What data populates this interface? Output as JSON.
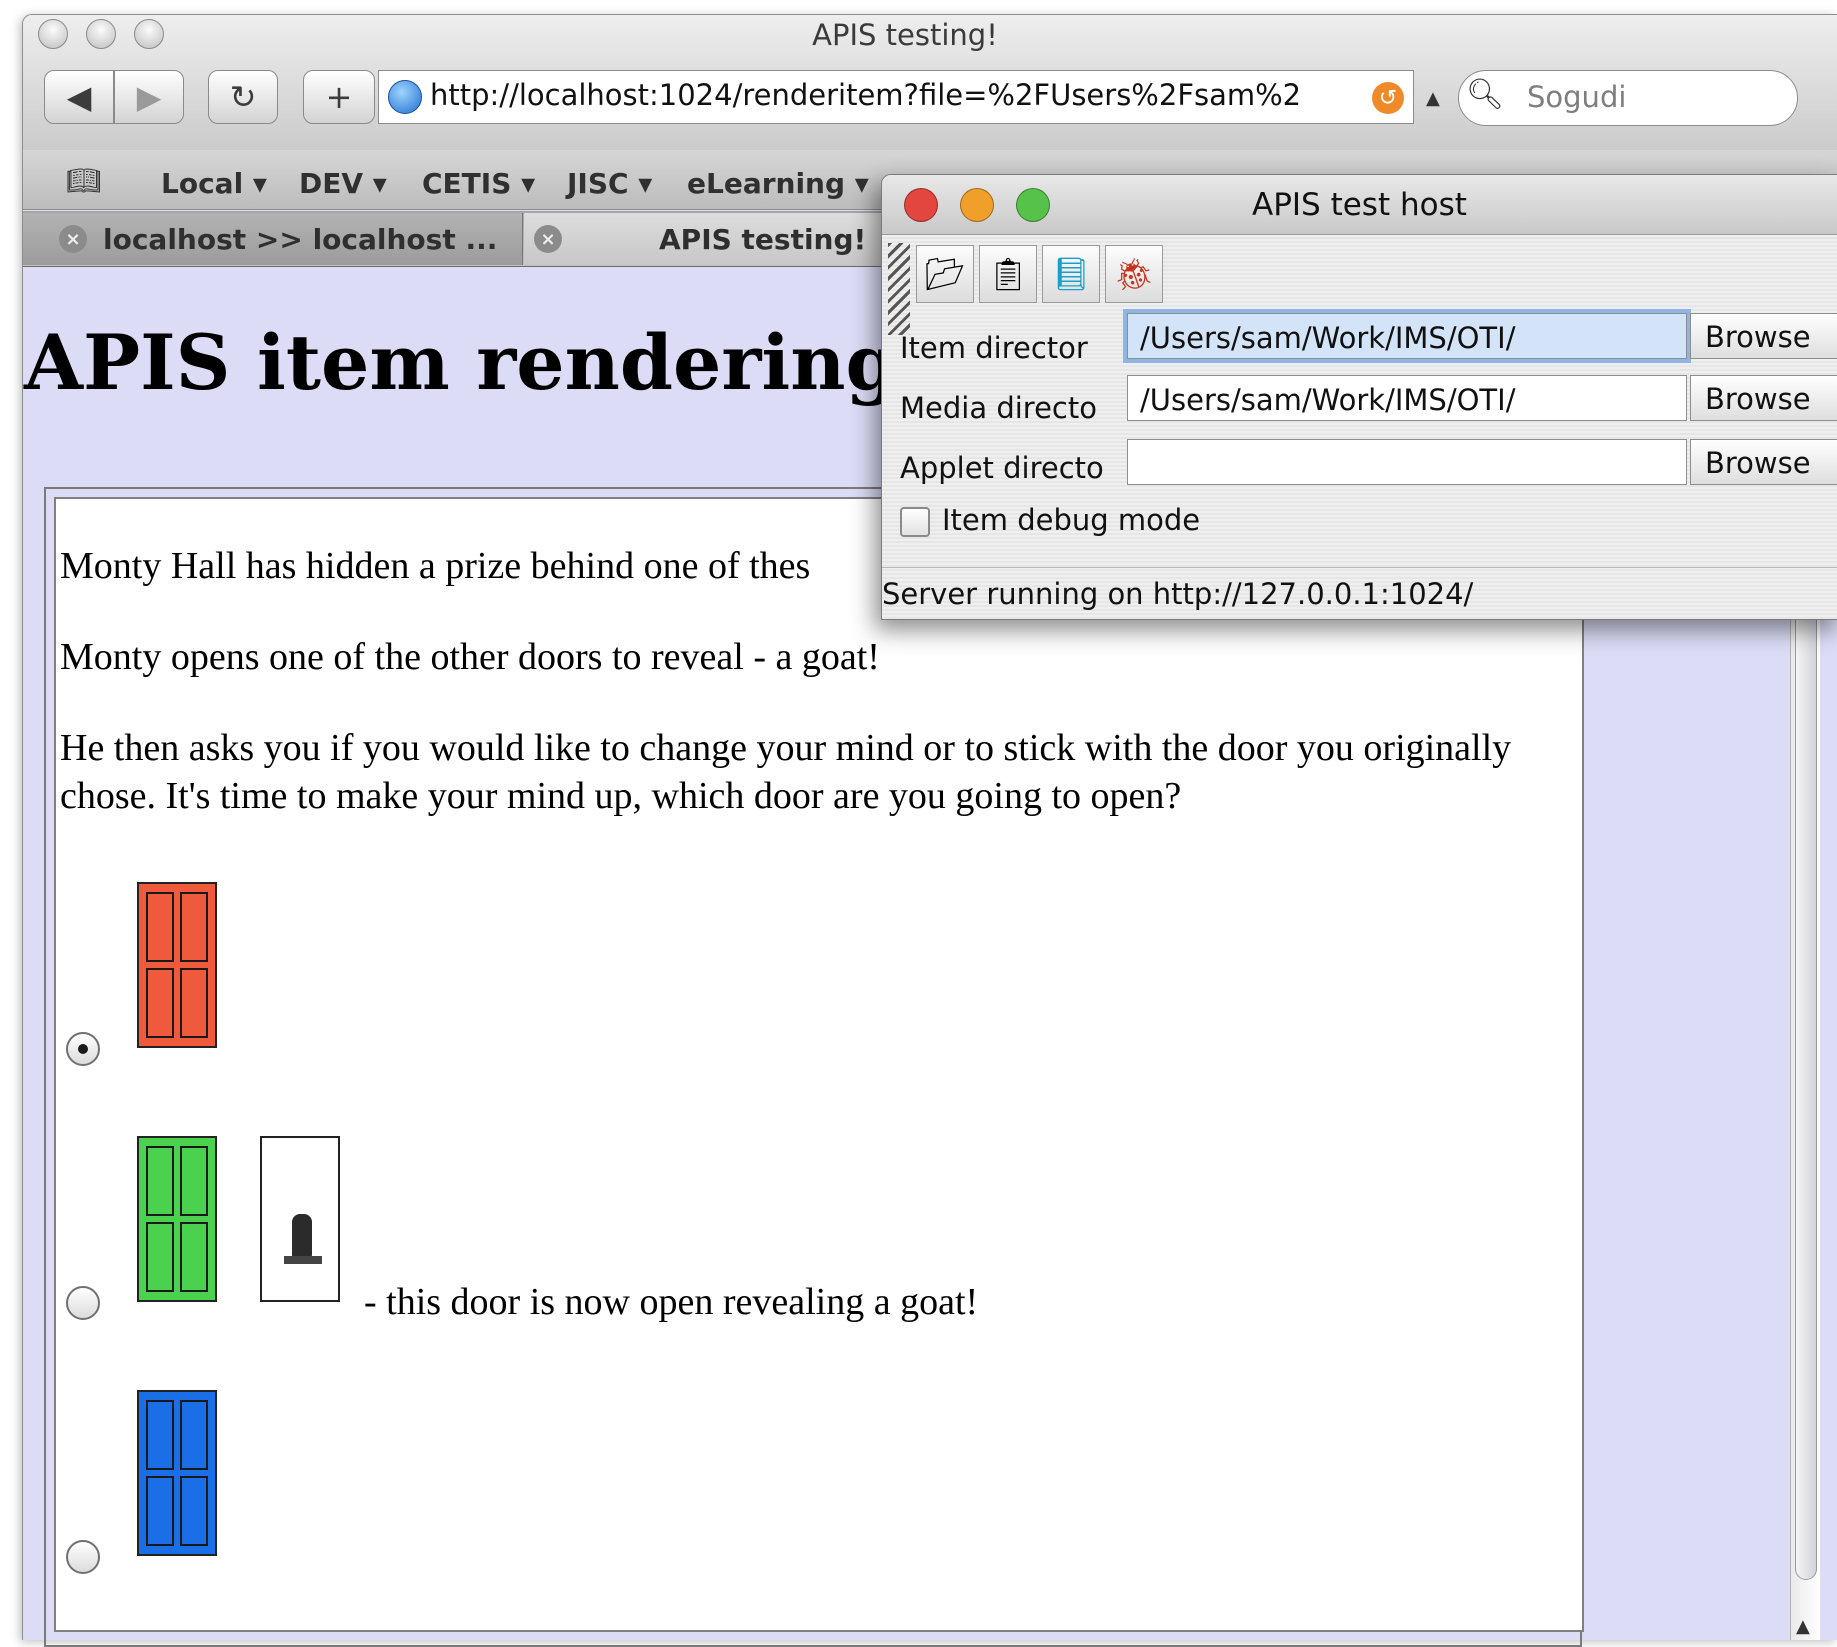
{
  "browser": {
    "window_title": "APIS testing!",
    "url": "http://localhost:1024/renderitem?file=%2FUsers%2Fsam%2",
    "search_placeholder": "Sogudi",
    "toolbar": {
      "back": "◀",
      "forward": "▶",
      "reload": "↻",
      "add": "+"
    },
    "bookmarks": [
      "Local ▾",
      "DEV ▾",
      "CETIS ▾",
      "JISC ▾",
      "eLearning ▾"
    ],
    "tabs": [
      {
        "label": "localhost >> localhost ...",
        "active": false
      },
      {
        "label": "APIS testing!",
        "active": true
      }
    ]
  },
  "page": {
    "title": "APIS item rendering te",
    "para1": "Monty Hall has hidden a prize behind one of thes",
    "para2": "Monty opens one of the other doors to reveal - a goat!",
    "para3": "He then asks you if you would like to change your mind or to stick with the door you originally chose. It's time to make your mind up, which door are you going to open?",
    "choices": [
      {
        "door_color": "#f05a3c",
        "selected": true
      },
      {
        "door_color": "#4ad14e",
        "selected": false,
        "caption": "- this door is now open revealing a goat!"
      },
      {
        "door_color": "#1a6fe6",
        "selected": false
      }
    ]
  },
  "host_window": {
    "title": "APIS test host",
    "fields": [
      {
        "label": "Item director",
        "value": "/Users/sam/Work/IMS/OTI/",
        "button": "Browse"
      },
      {
        "label": "Media directo",
        "value": "/Users/sam/Work/IMS/OTI/",
        "button": "Browse"
      },
      {
        "label": "Applet directo",
        "value": "",
        "button": "Browse"
      }
    ],
    "debug_label": "Item debug mode",
    "debug_checked": false,
    "status": "Server running on http://127.0.0.1:1024/"
  },
  "colors": {
    "page_background": "#dcdcf6",
    "close_red": "#e2463f",
    "minimize_orange": "#f0a02a",
    "zoom_green": "#57c24a"
  }
}
